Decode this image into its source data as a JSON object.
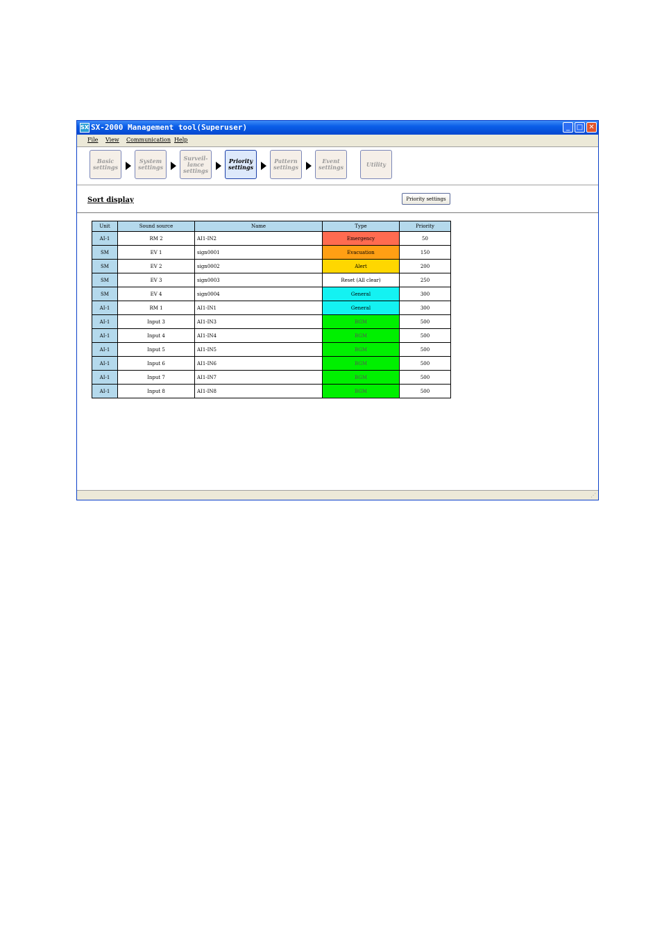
{
  "window": {
    "title": "SX-2000 Management tool(Superuser)",
    "app_icon": "SX",
    "controls": {
      "minimize": "_",
      "maximize": "□",
      "close": "✕"
    }
  },
  "menu": [
    "File",
    "View",
    "Communication",
    "Help"
  ],
  "steps": [
    {
      "lines": [
        "Basic",
        "settings"
      ],
      "active": false
    },
    {
      "lines": [
        "System",
        "settings"
      ],
      "active": false
    },
    {
      "lines": [
        "Surveil-",
        "lance",
        "settings"
      ],
      "active": false
    },
    {
      "lines": [
        "Priority",
        "settings"
      ],
      "active": true
    },
    {
      "lines": [
        "Pattern",
        "settings"
      ],
      "active": false
    },
    {
      "lines": [
        "Event",
        "settings"
      ],
      "active": false
    },
    {
      "lines": [
        "Utility"
      ],
      "active": false
    }
  ],
  "section": {
    "title": "Sort display",
    "priority_button": "Priority settings"
  },
  "table": {
    "headers": [
      "Unit",
      "Sound source",
      "Name",
      "Type",
      "Priority"
    ],
    "rows": [
      {
        "unit": "AI-1",
        "source": "RM 2",
        "name": "AI1-IN2",
        "type": "Emergency",
        "priority": "50",
        "type_bg": "#ff6b50",
        "type_fg": "#000000"
      },
      {
        "unit": "SM",
        "source": "EV 1",
        "name": "sign0001",
        "type": "Evacuation",
        "priority": "150",
        "type_bg": "#ff9f14",
        "type_fg": "#000000"
      },
      {
        "unit": "SM",
        "source": "EV 2",
        "name": "sign0002",
        "type": "Alert",
        "priority": "200",
        "type_bg": "#ffd700",
        "type_fg": "#000000"
      },
      {
        "unit": "SM",
        "source": "EV 3",
        "name": "sign0003",
        "type": "Reset (All clear)",
        "priority": "250",
        "type_bg": "#ffffff",
        "type_fg": "#000000"
      },
      {
        "unit": "SM",
        "source": "EV 4",
        "name": "sign0004",
        "type": "General",
        "priority": "300",
        "type_bg": "#14f2f2",
        "type_fg": "#000000"
      },
      {
        "unit": "AI-1",
        "source": "RM 1",
        "name": "AI1-IN1",
        "type": "General",
        "priority": "300",
        "type_bg": "#14f2f2",
        "type_fg": "#000000"
      },
      {
        "unit": "AI-1",
        "source": "Input 3",
        "name": "AI1-IN3",
        "type": "BGM",
        "priority": "500",
        "type_bg": "#00f000",
        "type_fg": "#555555"
      },
      {
        "unit": "AI-1",
        "source": "Input 4",
        "name": "AI1-IN4",
        "type": "BGM",
        "priority": "500",
        "type_bg": "#00f000",
        "type_fg": "#555555"
      },
      {
        "unit": "AI-1",
        "source": "Input 5",
        "name": "AI1-IN5",
        "type": "BGM",
        "priority": "500",
        "type_bg": "#00f000",
        "type_fg": "#555555"
      },
      {
        "unit": "AI-1",
        "source": "Input 6",
        "name": "AI1-IN6",
        "type": "BGM",
        "priority": "500",
        "type_bg": "#00f000",
        "type_fg": "#555555"
      },
      {
        "unit": "AI-1",
        "source": "Input 7",
        "name": "AI1-IN7",
        "type": "BGM",
        "priority": "500",
        "type_bg": "#00f000",
        "type_fg": "#555555"
      },
      {
        "unit": "AI-1",
        "source": "Input 8",
        "name": "AI1-IN8",
        "type": "BGM",
        "priority": "500",
        "type_bg": "#00f000",
        "type_fg": "#555555"
      }
    ]
  },
  "status": {
    "grip": "⋰"
  }
}
